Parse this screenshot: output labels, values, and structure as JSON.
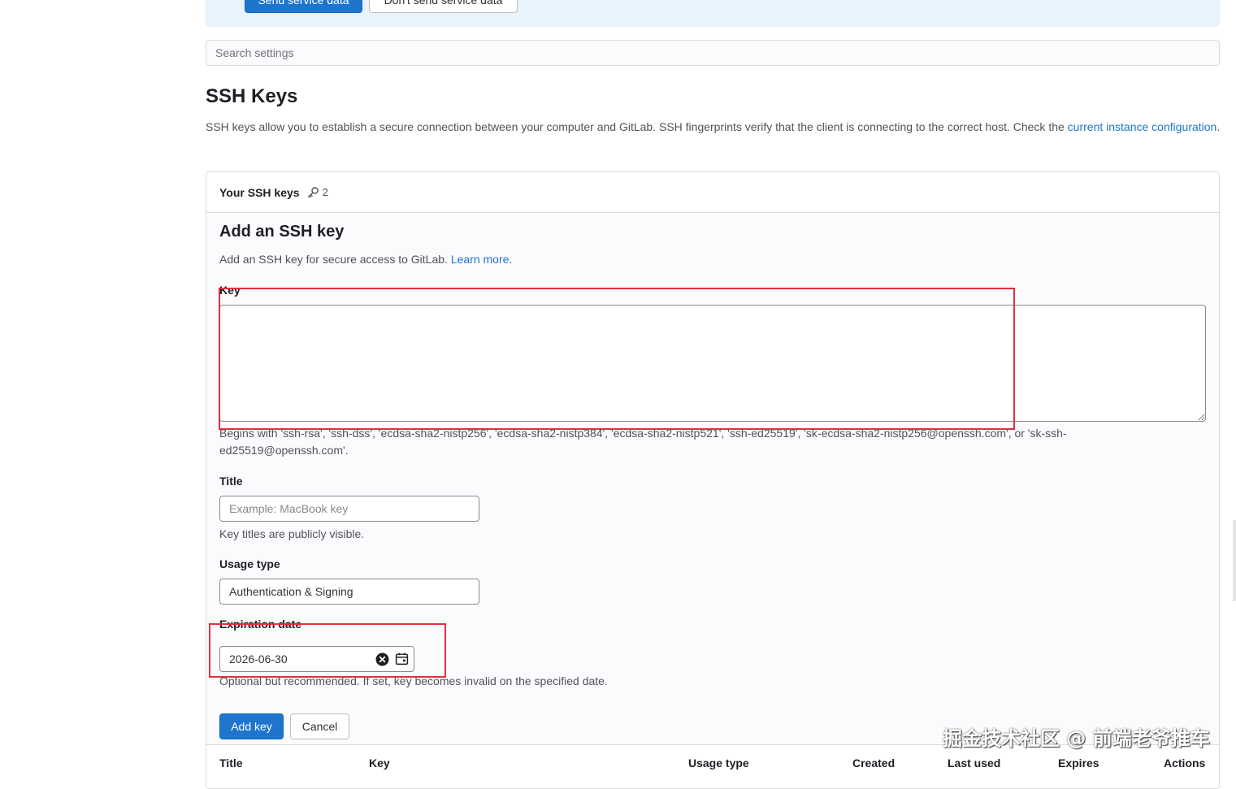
{
  "banner": {
    "send_label": "Send service data",
    "dont_send_label": "Don't send service data"
  },
  "search": {
    "placeholder": "Search settings"
  },
  "page": {
    "title": "SSH Keys",
    "intro_text": "SSH keys allow you to establish a secure connection between your computer and GitLab. SSH fingerprints verify that the client is connecting to the correct host. Check the ",
    "intro_link": "current instance configuration",
    "intro_end": "."
  },
  "card": {
    "header_title": "Your SSH keys",
    "key_count": "2",
    "add_title": "Add an SSH key",
    "add_desc_text": "Add an SSH key for secure access to GitLab. ",
    "add_desc_link": "Learn more",
    "add_desc_end": "."
  },
  "form": {
    "key_label": "Key",
    "key_value": "",
    "key_help": "Begins with 'ssh-rsa', 'ssh-dss', 'ecdsa-sha2-nistp256', 'ecdsa-sha2-nistp384', 'ecdsa-sha2-nistp521', 'ssh-ed25519', 'sk-ecdsa-sha2-nistp256@openssh.com', or 'sk-ssh-ed25519@openssh.com'.",
    "title_label": "Title",
    "title_placeholder": "Example: MacBook key",
    "title_help": "Key titles are publicly visible.",
    "usage_label": "Usage type",
    "usage_value": "Authentication & Signing",
    "expiration_label": "Expiration date",
    "expiration_value": "2026-06-30",
    "expiration_help": "Optional but recommended. If set, key becomes invalid on the specified date.",
    "add_key_label": "Add key",
    "cancel_label": "Cancel"
  },
  "table": {
    "columns": [
      "Title",
      "Key",
      "Usage type",
      "Created",
      "Last used",
      "Expires",
      "Actions"
    ]
  },
  "watermark": "掘金技术社区 @ 前端老爷推车",
  "icons": {
    "key_count_icon": "key-icon",
    "clear_icon": "clear-circle-icon",
    "calendar_icon": "calendar-icon"
  },
  "colors": {
    "primary": "#1f75cb",
    "annotation": "#e0313f",
    "banner_bg": "#e9f3fc"
  }
}
